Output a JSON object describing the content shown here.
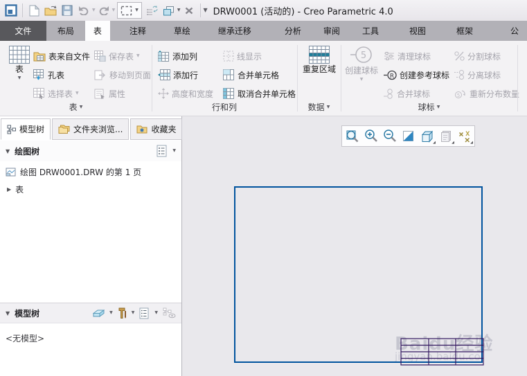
{
  "titlebar": {
    "title": "DRW0001 (活动的) - Creo Parametric 4.0"
  },
  "tabs": {
    "file": "文件",
    "layout": "布局",
    "table": "表",
    "annotate": "注释",
    "sketch": "草绘",
    "legacy": "继承迁移",
    "analysis": "分析",
    "review": "审阅",
    "tools": "工具",
    "view": "视图",
    "framework": "框架",
    "partial": "公"
  },
  "ribbon": {
    "table_group": {
      "label": "表",
      "big": "表",
      "from_file": "表来自文件",
      "save": "保存表",
      "hole": "孔表",
      "move": "移动到页面",
      "select": "选择表",
      "props": "属性"
    },
    "rowcol_group": {
      "label": "行和列",
      "add_col": "添加列",
      "line_disp": "线显示",
      "add_row": "添加行",
      "merge": "合并单元格",
      "height_width": "高度和宽度",
      "unmerge": "取消合并单元格"
    },
    "data_group": {
      "label": "数据",
      "big": "重复区域"
    },
    "balloon_group": {
      "label": "球标",
      "big": "创建球标",
      "cleanup": "清理球标",
      "create_ref": "创建参考球标",
      "merge": "合并球标",
      "split": "分割球标",
      "detach": "分离球标",
      "redistribute": "重新分布数量"
    }
  },
  "left": {
    "tabs": {
      "model": "模型树",
      "folder": "文件夹浏览...",
      "favorites": "收藏夹"
    },
    "drawing_tree": {
      "title": "绘图树",
      "item_page": "绘图 DRW0001.DRW 的第 1 页",
      "item_table": "表"
    },
    "model_tree": {
      "title": "模型树",
      "empty": "<无模型>"
    }
  },
  "canvas": {
    "watermark1": "Baidu经验",
    "watermark2": "jingyan.baidu.co",
    "colors": {
      "sheet_border": "#00539e",
      "title_block": "#32175f",
      "accent_teal": "#1e7e9a"
    }
  }
}
